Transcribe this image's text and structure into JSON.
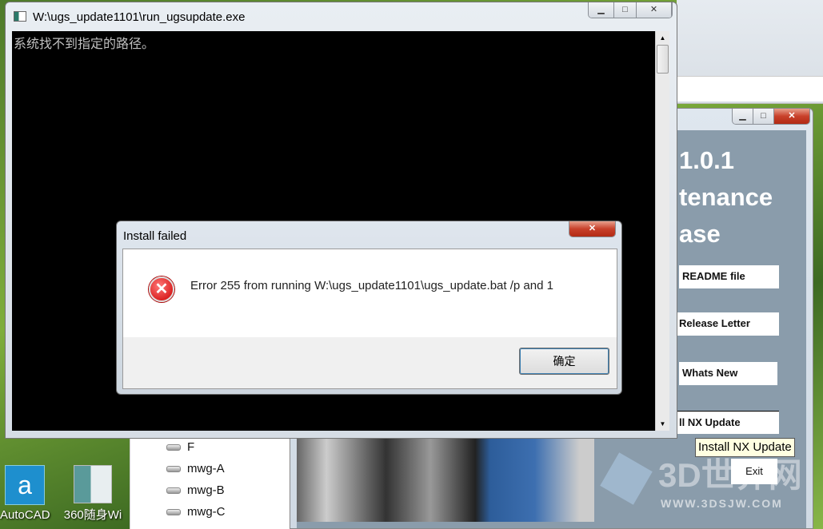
{
  "desktop": {
    "icons": [
      {
        "label": "AutoCAD",
        "icon": "autocad-icon"
      },
      {
        "label": "360随身Wi",
        "icon": "360-wifi-icon"
      }
    ]
  },
  "explorer": {
    "drives": [
      "F",
      "mwg-A",
      "mwg-B",
      "mwg-C"
    ]
  },
  "launcher": {
    "heading": [
      "1.0.1",
      "tenance",
      "ase"
    ],
    "buttons": [
      "README file",
      "Release Letter",
      "Whats New",
      "ll NX Update"
    ],
    "tooltip": "Install NX Update",
    "exit": "Exit",
    "watermark": "3D世界网",
    "watermark_url": "WWW.3DSJW.COM",
    "bg_color": "#8a9cab"
  },
  "console": {
    "title": "W:\\ugs_update1101\\run_ugsupdate.exe",
    "output": "系统找不到指定的路径。"
  },
  "dialog": {
    "title": "Install failed",
    "message": "Error 255 from running W:\\ugs_update1101\\ugs_update.bat /p and 1",
    "ok": "确定",
    "icon": "error-icon"
  }
}
